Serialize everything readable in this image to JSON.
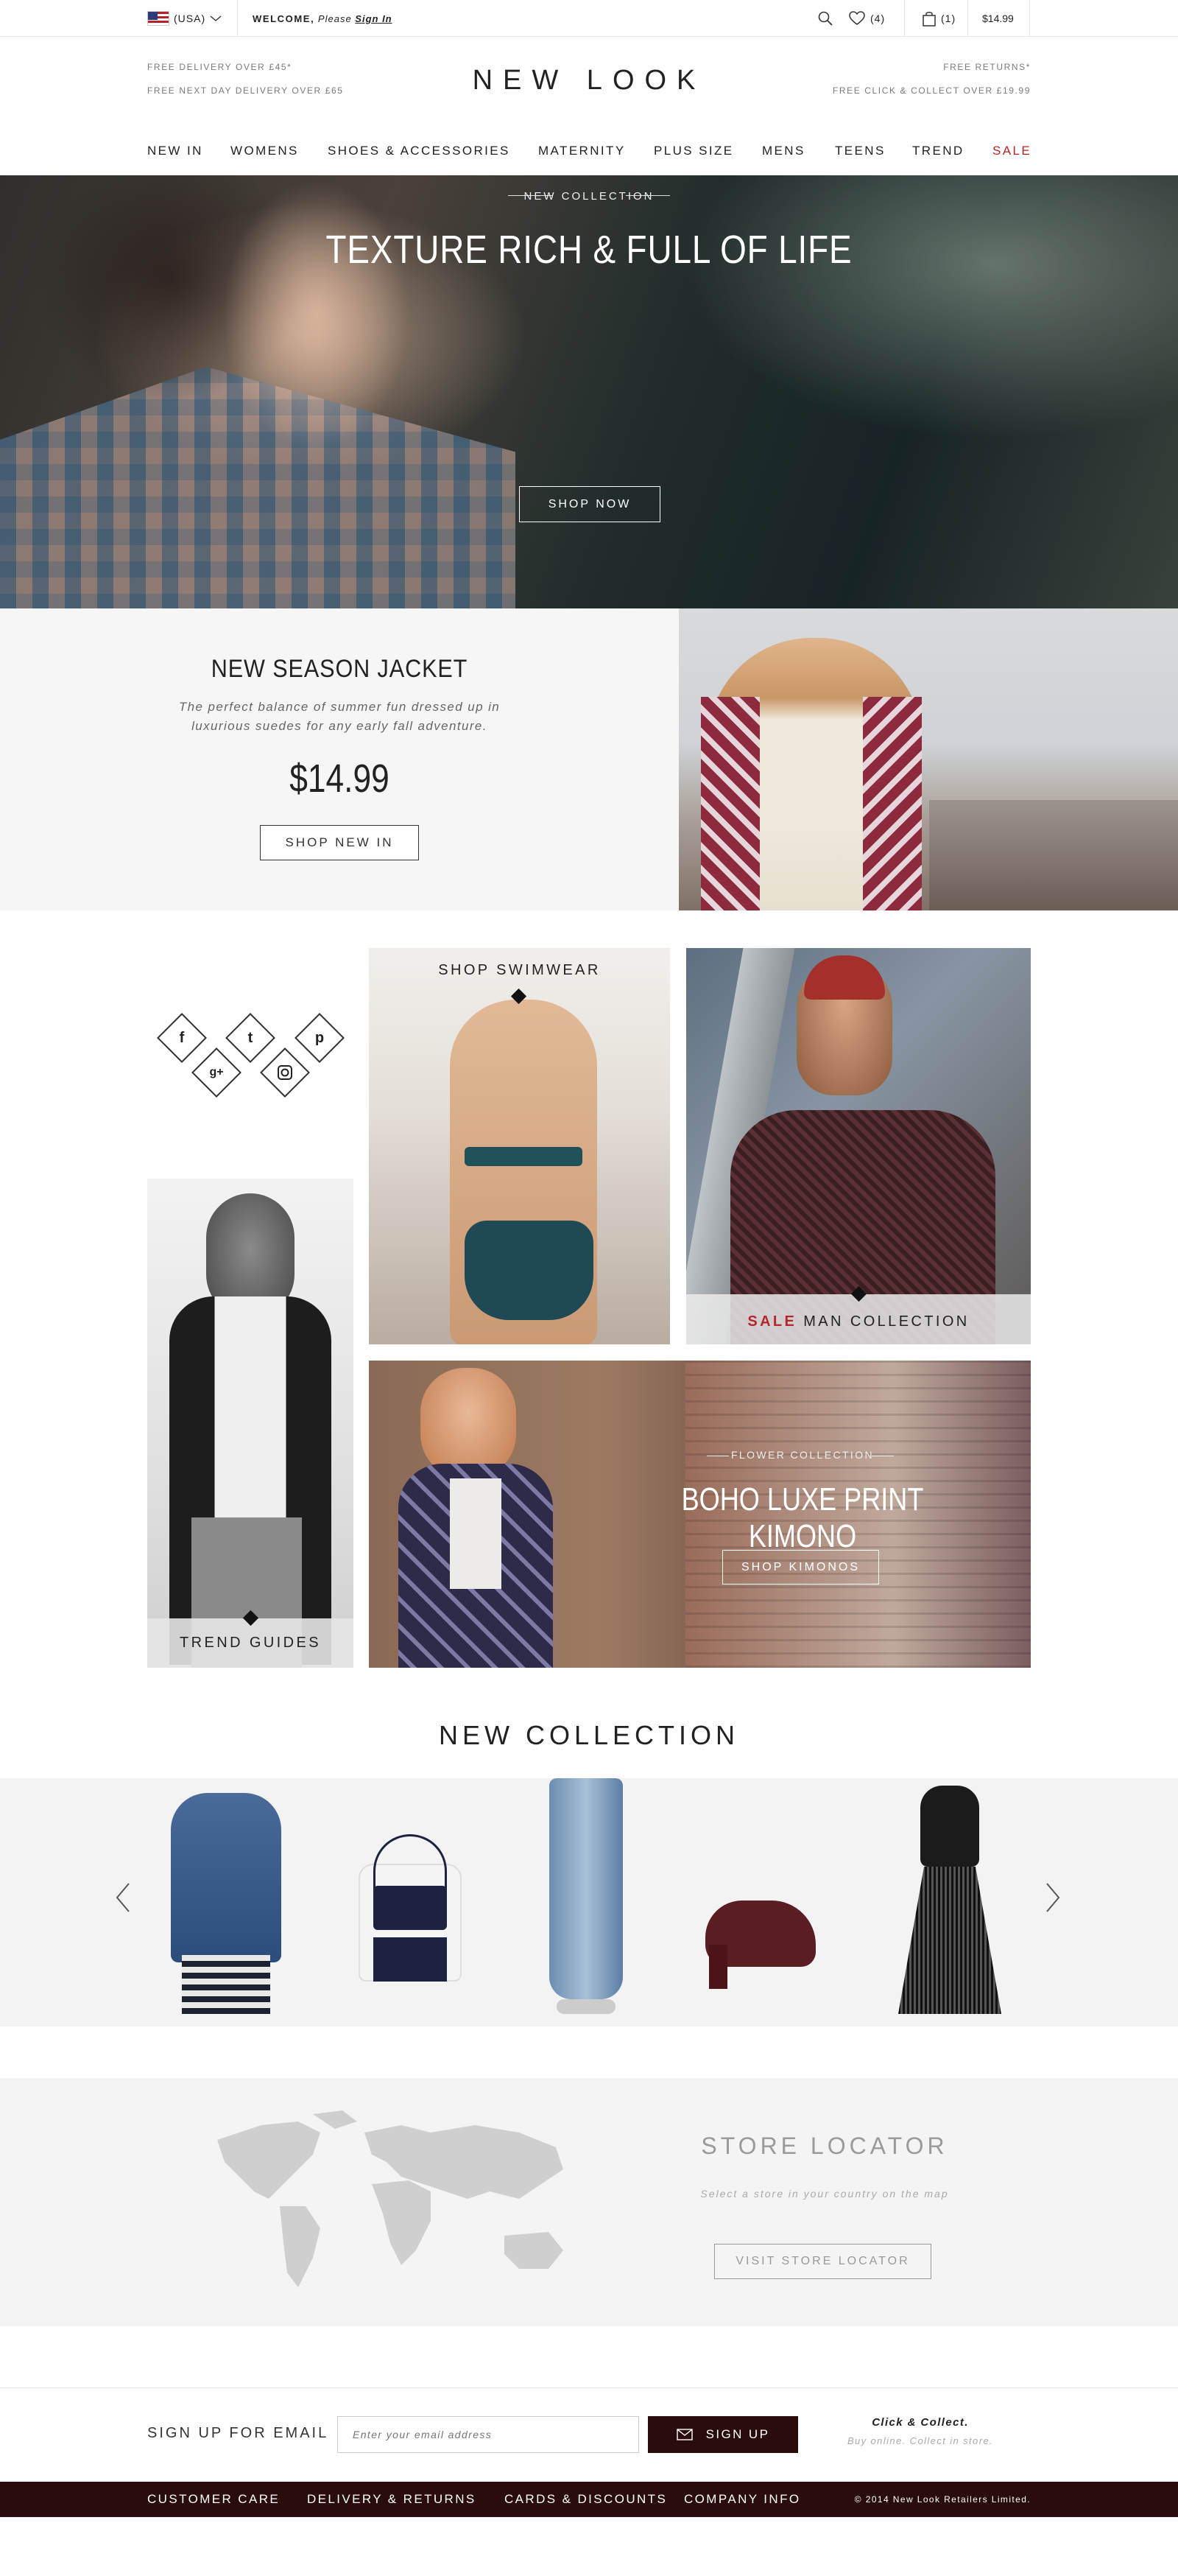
{
  "topbar": {
    "country": "(USA)",
    "welcome": "WELCOME,",
    "please": "Please",
    "sign_in": "Sign In",
    "wishlist_count": "(4)",
    "bag_count": "(1)",
    "bag_total": "$14.99"
  },
  "header": {
    "left_line1": "FREE DELIVERY OVER £45*",
    "left_line2": "FREE NEXT DAY DELIVERY OVER £65",
    "logo": "NEW LOOK",
    "right_line1": "FREE RETURNS*",
    "right_line2": "FREE CLICK & COLLECT OVER £19.99"
  },
  "nav": [
    "NEW IN",
    "WOMENS",
    "SHOES & ACCESSORIES",
    "MATERNITY",
    "PLUS SIZE",
    "MENS",
    "TEENS",
    "TREND",
    "SALE"
  ],
  "hero": {
    "kicker": "NEW COLLECTION",
    "title": "TEXTURE RICH & FULL OF LIFE",
    "button": "SHOP NOW"
  },
  "jacket": {
    "title": "NEW  SEASON JACKET",
    "desc1": "The perfect balance of summer fun dressed up in",
    "desc2": "luxurious suedes for any early fall adventure.",
    "price": "$14.99",
    "button": "SHOP NEW IN"
  },
  "social": [
    "f",
    "t",
    "p",
    "g+",
    "ig"
  ],
  "tiles": {
    "swimwear": "SHOP SWIMWEAR",
    "sale_word": "SALE",
    "man": "MAN COLLECTION",
    "trend": "TREND GUIDES",
    "kimono_kicker": "FLOWER COLLECTION",
    "kimono_title": "BOHO LUXE PRINT KIMONO",
    "kimono_button": "SHOP KIMONOS"
  },
  "new_collection": {
    "title": "NEW COLLECTION",
    "products": [
      "denim-parka",
      "backpack",
      "ripped-jeans",
      "burgundy-heels",
      "sheer-black-dress"
    ]
  },
  "store": {
    "title": "STORE LOCATOR",
    "subtitle": "Select a store in your country on the map",
    "button": "VISIT STORE LOCATOR"
  },
  "signup": {
    "label": "SIGN UP FOR EMAIL",
    "placeholder": "Enter your email address",
    "button": "SIGN UP",
    "cc_title": "Click & Collect.",
    "cc_sub": "Buy online. Collect in store."
  },
  "footer": {
    "links": [
      "CUSTOMER CARE",
      "DELIVERY & RETURNS",
      "CARDS & DISCOUNTS",
      "COMPANY INFO"
    ],
    "copyright": "© 2014 New Look Retailers Limited."
  },
  "colors": {
    "accent": "#b3262b",
    "footer_bg": "#2a0c0c",
    "signup_button": "#2a0c0c"
  }
}
